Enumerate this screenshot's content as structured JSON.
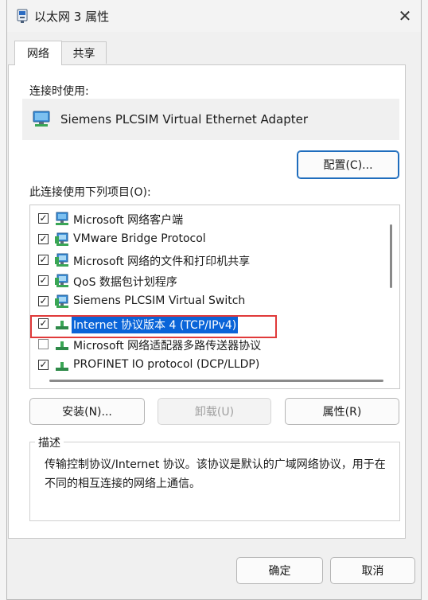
{
  "window": {
    "title": "以太网 3 属性",
    "close_symbol": "✕"
  },
  "tabs": [
    {
      "label": "网络",
      "active": true
    },
    {
      "label": "共享",
      "active": false
    }
  ],
  "connect_using": {
    "label": "连接时使用:",
    "adapter": "Siemens PLCSIM Virtual Ethernet Adapter",
    "configure_button": "配置(C)..."
  },
  "items_section": {
    "label": "此连接使用下列项目(O):",
    "items": [
      {
        "label": "Microsoft 网络客户端",
        "checked": true,
        "check": "✓",
        "icon": "network-client-icon"
      },
      {
        "label": "VMware Bridge Protocol",
        "checked": true,
        "check": "✓",
        "icon": "network-service-icon"
      },
      {
        "label": "Microsoft 网络的文件和打印机共享",
        "checked": true,
        "check": "✓",
        "icon": "network-service-icon"
      },
      {
        "label": "QoS 数据包计划程序",
        "checked": true,
        "check": "✓",
        "icon": "network-service-icon"
      },
      {
        "label": "Siemens PLCSIM Virtual Switch",
        "checked": true,
        "check": "✓",
        "icon": "network-service-icon"
      },
      {
        "label": "Internet 协议版本 4 (TCP/IPv4)",
        "checked": true,
        "check": "✓",
        "icon": "protocol-icon",
        "selected": true
      },
      {
        "label": "Microsoft 网络适配器多路传送器协议",
        "checked": false,
        "check": "",
        "icon": "protocol-icon"
      },
      {
        "label": "PROFINET IO protocol (DCP/LLDP)",
        "checked": true,
        "check": "✓",
        "icon": "protocol-icon"
      }
    ]
  },
  "action_buttons": {
    "install": "安装(N)...",
    "uninstall": "卸载(U)",
    "properties": "属性(R)"
  },
  "description": {
    "title": "描述",
    "text": "传输控制协议/Internet 协议。该协议是默认的广域网络协议，用于在不同的相互连接的网络上通信。"
  },
  "footer": {
    "ok": "确定",
    "cancel": "取消"
  },
  "colors": {
    "selection": "#0a64d8",
    "highlight_box": "#e03a3a",
    "accent_border": "#1f6dbd"
  }
}
